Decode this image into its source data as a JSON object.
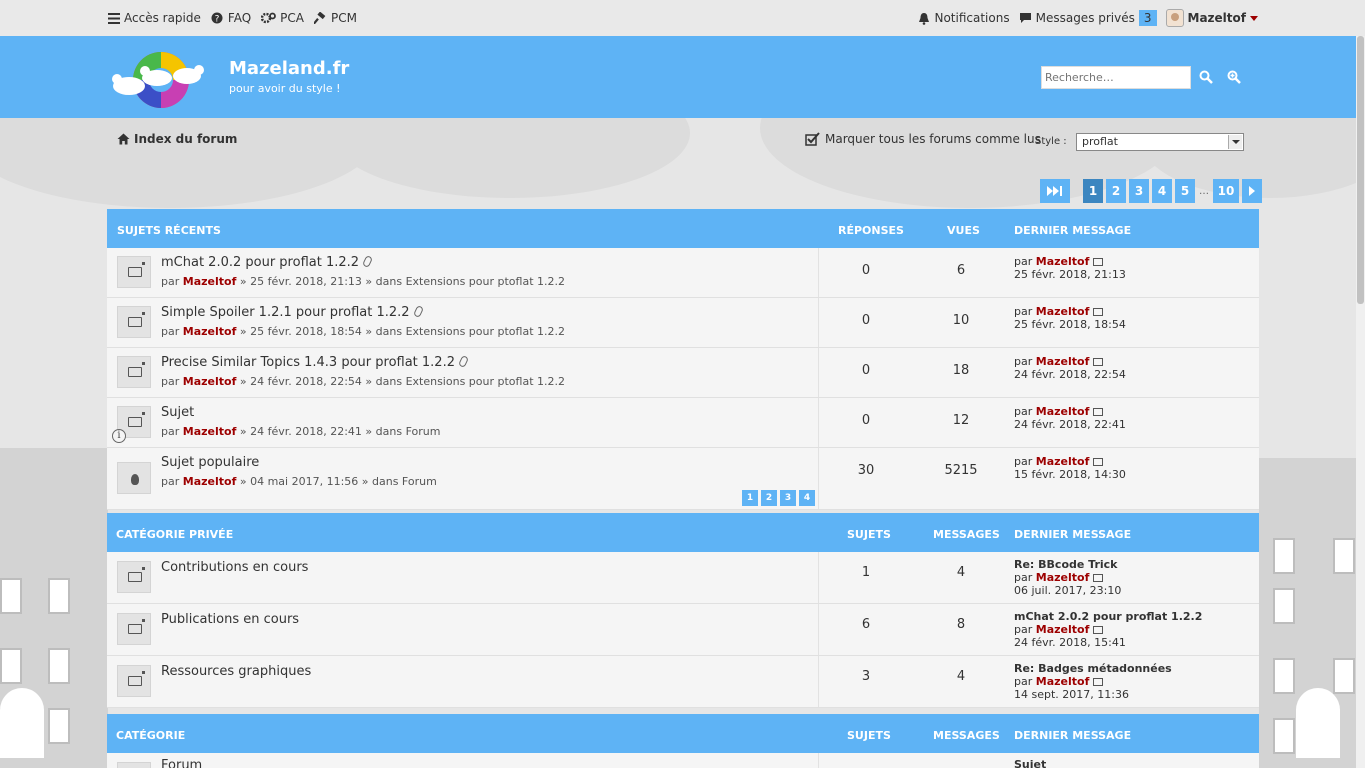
{
  "topbar": {
    "quick_access": "Accès rapide",
    "faq": "FAQ",
    "acp": "PCA",
    "mcp": "PCM",
    "notifications": "Notifications",
    "private_messages": "Messages privés",
    "pm_count": "3",
    "username": "Mazeltof"
  },
  "header": {
    "site_title": "Mazeland.fr",
    "site_desc": "pour avoir du style !",
    "search_placeholder": "Recherche…"
  },
  "nav": {
    "index": "Index du forum",
    "mark_read": "Marquer tous les forums comme lus",
    "style_label": "Style :",
    "style_value": "proflat"
  },
  "pagination": {
    "pages": [
      "1",
      "2",
      "3",
      "4",
      "5"
    ],
    "dots": "…",
    "last": "10",
    "current": "1"
  },
  "recent": {
    "title": "SUJETS RÉCENTS",
    "col_replies": "RÉPONSES",
    "col_views": "VUES",
    "col_last": "DERNIER MESSAGE",
    "topics": [
      {
        "title": "mChat 2.0.2 pour proflat 1.2.2",
        "by": "par",
        "author": "Mazeltof",
        "date": "» 25 févr. 2018, 21:13 » dans Extensions pour ptoflat 1.2.2",
        "replies": "0",
        "views": "6",
        "last_by": "par",
        "last_author": "Mazeltof",
        "last_date": "25 févr. 2018, 21:13",
        "attachment": true
      },
      {
        "title": "Simple Spoiler 1.2.1 pour proflat 1.2.2",
        "by": "par",
        "author": "Mazeltof",
        "date": "» 25 févr. 2018, 18:54 » dans Extensions pour ptoflat 1.2.2",
        "replies": "0",
        "views": "10",
        "last_by": "par",
        "last_author": "Mazeltof",
        "last_date": "25 févr. 2018, 18:54",
        "attachment": true
      },
      {
        "title": "Precise Similar Topics 1.4.3 pour proflat 1.2.2",
        "by": "par",
        "author": "Mazeltof",
        "date": "» 24 févr. 2018, 22:54 » dans Extensions pour ptoflat 1.2.2",
        "replies": "0",
        "views": "18",
        "last_by": "par",
        "last_author": "Mazeltof",
        "last_date": "24 févr. 2018, 22:54",
        "attachment": true
      },
      {
        "title": "Sujet",
        "by": "par",
        "author": "Mazeltof",
        "date": "» 24 févr. 2018, 22:41 » dans Forum",
        "replies": "0",
        "views": "12",
        "last_by": "par",
        "last_author": "Mazeltof",
        "last_date": "24 févr. 2018, 22:41",
        "attachment": false
      },
      {
        "title": "Sujet populaire",
        "by": "par",
        "author": "Mazeltof",
        "date": "» 04 mai 2017, 11:56 » dans Forum",
        "replies": "30",
        "views": "5215",
        "last_by": "par",
        "last_author": "Mazeltof",
        "last_date": "15 févr. 2018, 14:30",
        "attachment": false,
        "pages": [
          "1",
          "2",
          "3",
          "4"
        ]
      }
    ]
  },
  "private_cat": {
    "title": "CATÉGORIE PRIVÉE",
    "col_topics": "SUJETS",
    "col_posts": "MESSAGES",
    "col_last": "DERNIER MESSAGE",
    "forums": [
      {
        "name": "Contributions en cours",
        "topics": "1",
        "posts": "4",
        "last_title": "Re: BBcode Trick",
        "last_by": "par",
        "last_author": "Mazeltof",
        "last_date": "06 juil. 2017, 23:10"
      },
      {
        "name": "Publications en cours",
        "topics": "6",
        "posts": "8",
        "last_title": "mChat 2.0.2 pour proflat 1.2.2",
        "last_by": "par",
        "last_author": "Mazeltof",
        "last_date": "24 févr. 2018, 15:41"
      },
      {
        "name": "Ressources graphiques",
        "topics": "3",
        "posts": "4",
        "last_title": "Re: Badges métadonnées",
        "last_by": "par",
        "last_author": "Mazeltof",
        "last_date": "14 sept. 2017, 11:36"
      }
    ]
  },
  "category": {
    "title": "CATÉGORIE",
    "col_topics": "SUJETS",
    "col_posts": "MESSAGES",
    "col_last": "DERNIER MESSAGE",
    "forums": [
      {
        "name": "Forum",
        "last_title": "Sujet"
      }
    ]
  },
  "colors": {
    "accent": "#5eb3f5",
    "active_page": "#3c86c0",
    "username": "#9d0000"
  },
  "icons": [
    "menu-icon",
    "faq-icon",
    "gear-icon",
    "hammer-icon",
    "bell-icon",
    "speech-bubble-icon",
    "search-icon",
    "advanced-search-icon",
    "home-icon",
    "checkbox-icon",
    "last-page-icon",
    "next-page-icon",
    "topic-icon",
    "hot-topic-icon",
    "paperclip-icon",
    "view-latest-icon",
    "info-icon"
  ]
}
